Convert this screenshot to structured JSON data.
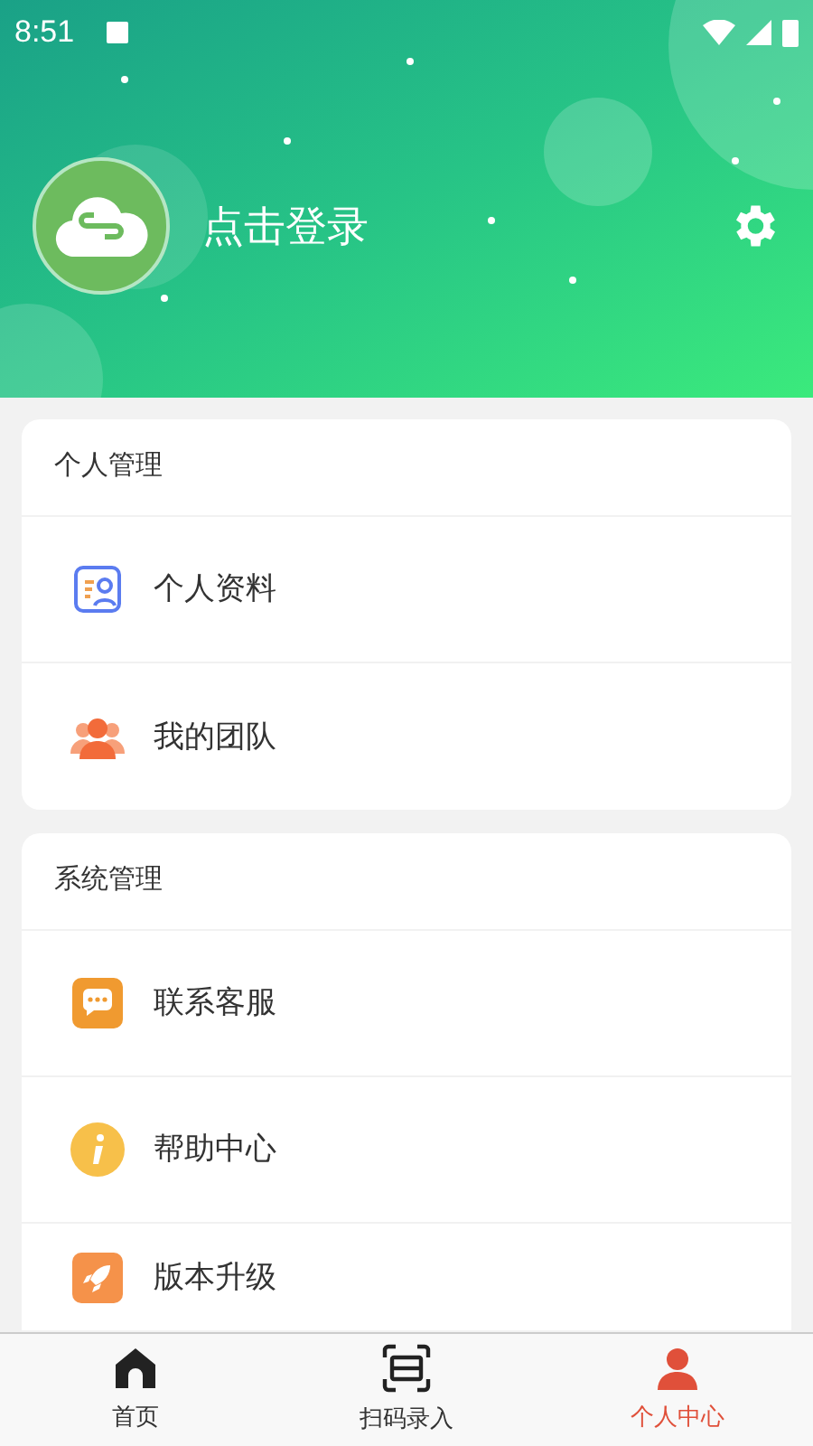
{
  "status_bar": {
    "time": "8:51"
  },
  "profile": {
    "login_label": "点击登录"
  },
  "sections": [
    {
      "title": "个人管理",
      "items": [
        {
          "kind": "profile",
          "label": "个人资料"
        },
        {
          "kind": "team",
          "label": "我的团队"
        }
      ]
    },
    {
      "title": "系统管理",
      "items": [
        {
          "kind": "chat",
          "label": "联系客服"
        },
        {
          "kind": "info",
          "label": "帮助中心"
        },
        {
          "kind": "rocket",
          "label": "版本升级"
        }
      ]
    }
  ],
  "tabs": [
    {
      "kind": "home",
      "label": "首页",
      "selected": false
    },
    {
      "kind": "scan",
      "label": "扫码录入",
      "selected": false
    },
    {
      "kind": "person",
      "label": "个人中心",
      "selected": true
    }
  ]
}
